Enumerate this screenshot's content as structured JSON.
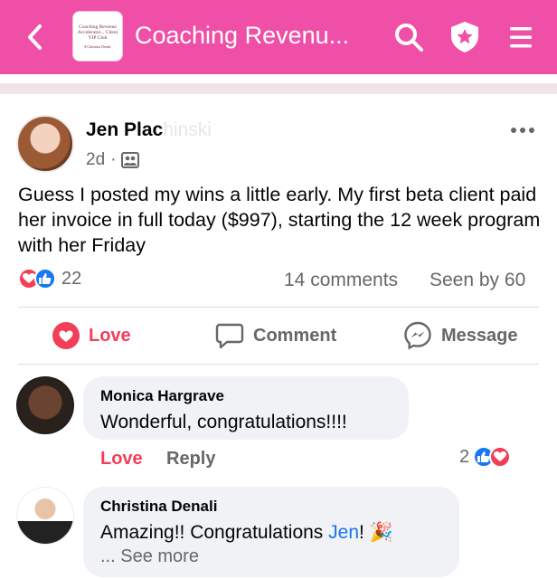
{
  "header": {
    "group_title": "Coaching Revenu...",
    "group_thumb_line1": "Coaching Revenue Accelerator... Client VIP Club",
    "group_thumb_line2": "$ Christina Denali",
    "icons": [
      "chevron-left-icon",
      "search-icon",
      "shield-star-icon",
      "menu-icon"
    ],
    "color": "#ef4fa6"
  },
  "post": {
    "author_visible": "Jen Plac",
    "author_faded": "hinski",
    "time": "2d",
    "separator": "·",
    "text": "Guess I posted my wins a little early. My first beta client paid her invoice in full today ($997), starting the 12 week program with her Friday",
    "reaction_count": "22",
    "comments": "14 comments",
    "seen": "Seen by 60",
    "actions": {
      "love": "Love",
      "comment": "Comment",
      "message": "Message"
    }
  },
  "comments": [
    {
      "name": "Monica Hargrave",
      "text": "Wonderful, congratulations!!!!",
      "love": "Love",
      "reply": "Reply",
      "reaction_count": "2"
    },
    {
      "name": "Christina Denali",
      "text_before": "Amazing!! Congratulations ",
      "mention": "Jen",
      "text_after": "! 🎉",
      "see_more": "... See more"
    }
  ],
  "colors": {
    "love": "#f33e58",
    "like": "#1877f2",
    "muted": "#65676b"
  }
}
